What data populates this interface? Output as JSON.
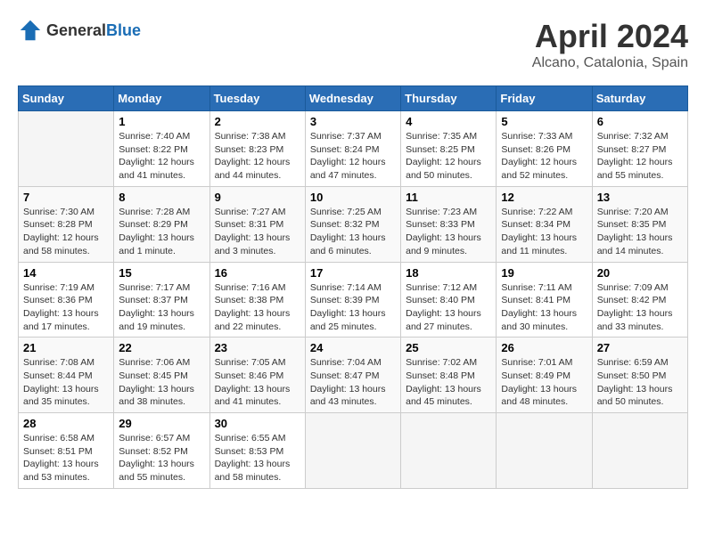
{
  "header": {
    "logo_general": "General",
    "logo_blue": "Blue",
    "title": "April 2024",
    "subtitle": "Alcano, Catalonia, Spain"
  },
  "calendar": {
    "columns": [
      "Sunday",
      "Monday",
      "Tuesday",
      "Wednesday",
      "Thursday",
      "Friday",
      "Saturday"
    ],
    "rows": [
      [
        {
          "day": "",
          "info": ""
        },
        {
          "day": "1",
          "info": "Sunrise: 7:40 AM\nSunset: 8:22 PM\nDaylight: 12 hours\nand 41 minutes."
        },
        {
          "day": "2",
          "info": "Sunrise: 7:38 AM\nSunset: 8:23 PM\nDaylight: 12 hours\nand 44 minutes."
        },
        {
          "day": "3",
          "info": "Sunrise: 7:37 AM\nSunset: 8:24 PM\nDaylight: 12 hours\nand 47 minutes."
        },
        {
          "day": "4",
          "info": "Sunrise: 7:35 AM\nSunset: 8:25 PM\nDaylight: 12 hours\nand 50 minutes."
        },
        {
          "day": "5",
          "info": "Sunrise: 7:33 AM\nSunset: 8:26 PM\nDaylight: 12 hours\nand 52 minutes."
        },
        {
          "day": "6",
          "info": "Sunrise: 7:32 AM\nSunset: 8:27 PM\nDaylight: 12 hours\nand 55 minutes."
        }
      ],
      [
        {
          "day": "7",
          "info": "Sunrise: 7:30 AM\nSunset: 8:28 PM\nDaylight: 12 hours\nand 58 minutes."
        },
        {
          "day": "8",
          "info": "Sunrise: 7:28 AM\nSunset: 8:29 PM\nDaylight: 13 hours\nand 1 minute."
        },
        {
          "day": "9",
          "info": "Sunrise: 7:27 AM\nSunset: 8:31 PM\nDaylight: 13 hours\nand 3 minutes."
        },
        {
          "day": "10",
          "info": "Sunrise: 7:25 AM\nSunset: 8:32 PM\nDaylight: 13 hours\nand 6 minutes."
        },
        {
          "day": "11",
          "info": "Sunrise: 7:23 AM\nSunset: 8:33 PM\nDaylight: 13 hours\nand 9 minutes."
        },
        {
          "day": "12",
          "info": "Sunrise: 7:22 AM\nSunset: 8:34 PM\nDaylight: 13 hours\nand 11 minutes."
        },
        {
          "day": "13",
          "info": "Sunrise: 7:20 AM\nSunset: 8:35 PM\nDaylight: 13 hours\nand 14 minutes."
        }
      ],
      [
        {
          "day": "14",
          "info": "Sunrise: 7:19 AM\nSunset: 8:36 PM\nDaylight: 13 hours\nand 17 minutes."
        },
        {
          "day": "15",
          "info": "Sunrise: 7:17 AM\nSunset: 8:37 PM\nDaylight: 13 hours\nand 19 minutes."
        },
        {
          "day": "16",
          "info": "Sunrise: 7:16 AM\nSunset: 8:38 PM\nDaylight: 13 hours\nand 22 minutes."
        },
        {
          "day": "17",
          "info": "Sunrise: 7:14 AM\nSunset: 8:39 PM\nDaylight: 13 hours\nand 25 minutes."
        },
        {
          "day": "18",
          "info": "Sunrise: 7:12 AM\nSunset: 8:40 PM\nDaylight: 13 hours\nand 27 minutes."
        },
        {
          "day": "19",
          "info": "Sunrise: 7:11 AM\nSunset: 8:41 PM\nDaylight: 13 hours\nand 30 minutes."
        },
        {
          "day": "20",
          "info": "Sunrise: 7:09 AM\nSunset: 8:42 PM\nDaylight: 13 hours\nand 33 minutes."
        }
      ],
      [
        {
          "day": "21",
          "info": "Sunrise: 7:08 AM\nSunset: 8:44 PM\nDaylight: 13 hours\nand 35 minutes."
        },
        {
          "day": "22",
          "info": "Sunrise: 7:06 AM\nSunset: 8:45 PM\nDaylight: 13 hours\nand 38 minutes."
        },
        {
          "day": "23",
          "info": "Sunrise: 7:05 AM\nSunset: 8:46 PM\nDaylight: 13 hours\nand 41 minutes."
        },
        {
          "day": "24",
          "info": "Sunrise: 7:04 AM\nSunset: 8:47 PM\nDaylight: 13 hours\nand 43 minutes."
        },
        {
          "day": "25",
          "info": "Sunrise: 7:02 AM\nSunset: 8:48 PM\nDaylight: 13 hours\nand 45 minutes."
        },
        {
          "day": "26",
          "info": "Sunrise: 7:01 AM\nSunset: 8:49 PM\nDaylight: 13 hours\nand 48 minutes."
        },
        {
          "day": "27",
          "info": "Sunrise: 6:59 AM\nSunset: 8:50 PM\nDaylight: 13 hours\nand 50 minutes."
        }
      ],
      [
        {
          "day": "28",
          "info": "Sunrise: 6:58 AM\nSunset: 8:51 PM\nDaylight: 13 hours\nand 53 minutes."
        },
        {
          "day": "29",
          "info": "Sunrise: 6:57 AM\nSunset: 8:52 PM\nDaylight: 13 hours\nand 55 minutes."
        },
        {
          "day": "30",
          "info": "Sunrise: 6:55 AM\nSunset: 8:53 PM\nDaylight: 13 hours\nand 58 minutes."
        },
        {
          "day": "",
          "info": ""
        },
        {
          "day": "",
          "info": ""
        },
        {
          "day": "",
          "info": ""
        },
        {
          "day": "",
          "info": ""
        }
      ]
    ]
  }
}
